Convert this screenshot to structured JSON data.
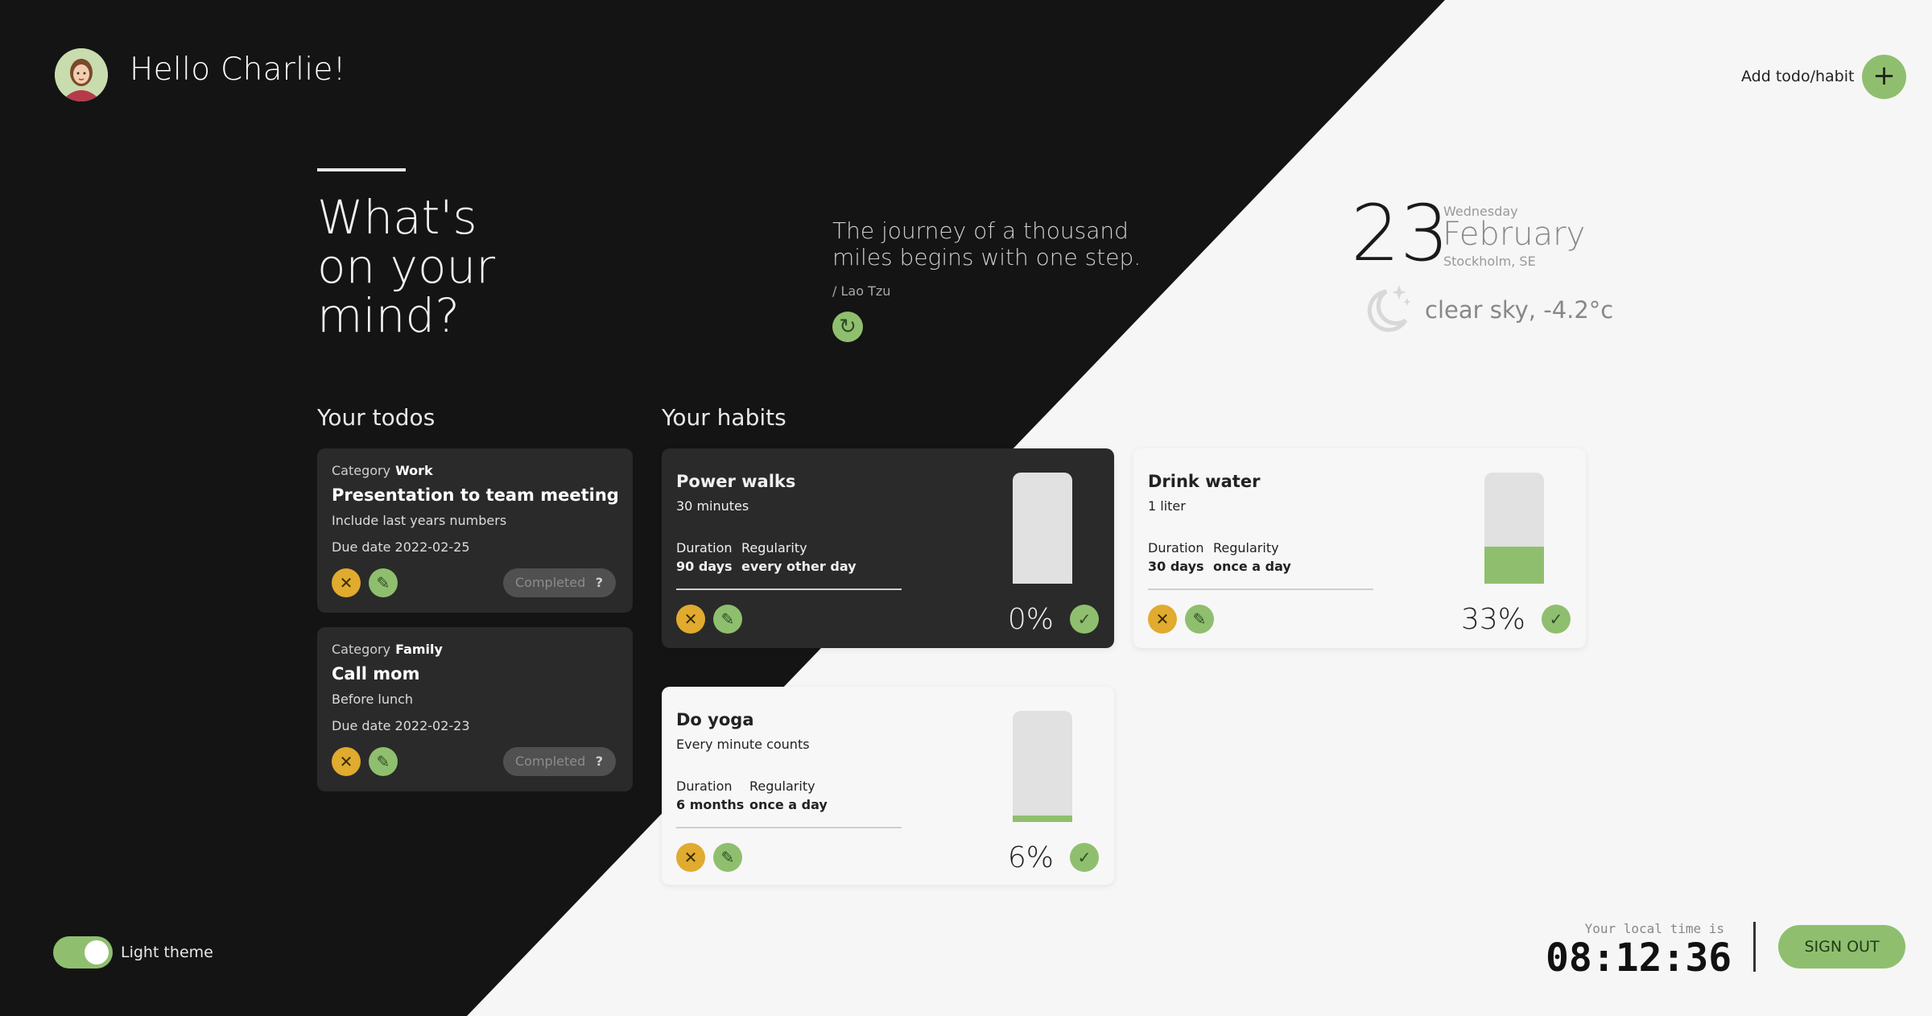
{
  "header": {
    "greeting": "Hello Charlie!",
    "add_label": "Add todo/habit",
    "add_icon": "+"
  },
  "hero": {
    "title_line1": "What's",
    "title_line2": "on your",
    "title_line3": "mind?"
  },
  "quote": {
    "text": "The journey of a thousand miles begins with one step.",
    "author": "/ Lao Tzu"
  },
  "date": {
    "day": "23",
    "weekday": "Wednesday",
    "month": "February",
    "location": "Stockholm, SE"
  },
  "weather": {
    "description": "clear sky, -4.2°c",
    "icon": "moon-stars-icon"
  },
  "todos": {
    "heading": "Your todos",
    "items": [
      {
        "category_label": "Category",
        "category": "Work",
        "title": "Presentation to team meeting",
        "description": "Include last years numbers",
        "due": "Due date 2022-02-25",
        "status": "Completed"
      },
      {
        "category_label": "Category",
        "category": "Family",
        "title": "Call mom",
        "description": "Before lunch",
        "due": "Due date 2022-02-23",
        "status": "Completed"
      }
    ]
  },
  "habits": {
    "heading": "Your habits",
    "items": [
      {
        "title": "Power walks",
        "subtitle": "30 minutes",
        "duration_label": "Duration",
        "duration": "90 days",
        "regularity_label": "Regularity",
        "regularity": "every other day",
        "percent": "0%",
        "progress": 0
      },
      {
        "title": "Drink water",
        "subtitle": "1 liter",
        "duration_label": "Duration",
        "duration": "30 days",
        "regularity_label": "Regularity",
        "regularity": "once a day",
        "percent": "33%",
        "progress": 33
      },
      {
        "title": "Do yoga",
        "subtitle": "Every minute counts",
        "duration_label": "Duration",
        "duration": "6 months",
        "regularity_label": "Regularity",
        "regularity": "once a day",
        "percent": "6%",
        "progress": 6
      }
    ]
  },
  "footer": {
    "theme_label": "Light theme",
    "theme_on": true,
    "time_label": "Your local time is",
    "time": "08:12:36",
    "signout": "SIGN OUT"
  },
  "colors": {
    "dark": "#141414",
    "card_dark": "#2a2a2a",
    "light": "#f6f6f6",
    "accent_green": "#8fbf6e",
    "accent_yellow": "#e0ab2e"
  }
}
